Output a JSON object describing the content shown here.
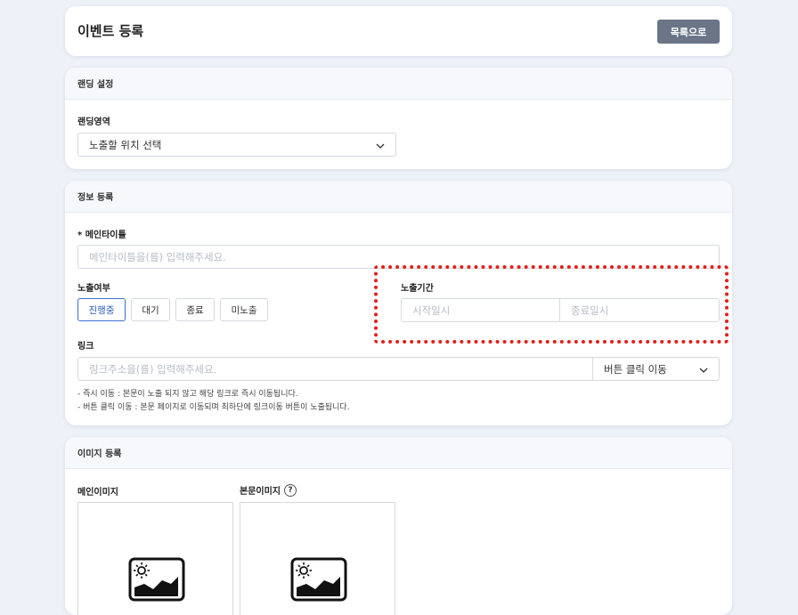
{
  "header": {
    "title": "이벤트 등록",
    "list_button": "목록으로"
  },
  "landing": {
    "section_title": "랜딩 설정",
    "area_label": "랜딩영역",
    "area_select_value": "노출할 위치 선택"
  },
  "info": {
    "section_title": "정보 등록",
    "main_title_label": "* 메인타이틀",
    "main_title_placeholder": "메인타이틀을(를) 입력해주세요.",
    "exposure_label": "노출여부",
    "status_buttons": [
      "진행중",
      "대기",
      "종료",
      "미노출"
    ],
    "period_label": "노출기간",
    "start_placeholder": "시작일시",
    "end_placeholder": "종료일시",
    "link_label": "링크",
    "link_placeholder": "링크주소을(를) 입력해주세요.",
    "link_select_value": "버튼 클릭 이동",
    "help_lines": [
      "- 즉시 이동 : 본문이 노출 되지 않고 해당 링크로 즉시 이동됩니다.",
      "- 버튼 클릭 이동 : 본문 페이지로 이동되며 최하단에 링크이동 버튼이 노출됩니다."
    ]
  },
  "images": {
    "section_title": "이미지 등록",
    "main_image_label": "메인이미지",
    "body_image_label": "본문이미지",
    "help_glyph": "?"
  },
  "colors": {
    "active": "#3b6fd4",
    "highlight": "#e0201a",
    "button": "#6b7587"
  }
}
